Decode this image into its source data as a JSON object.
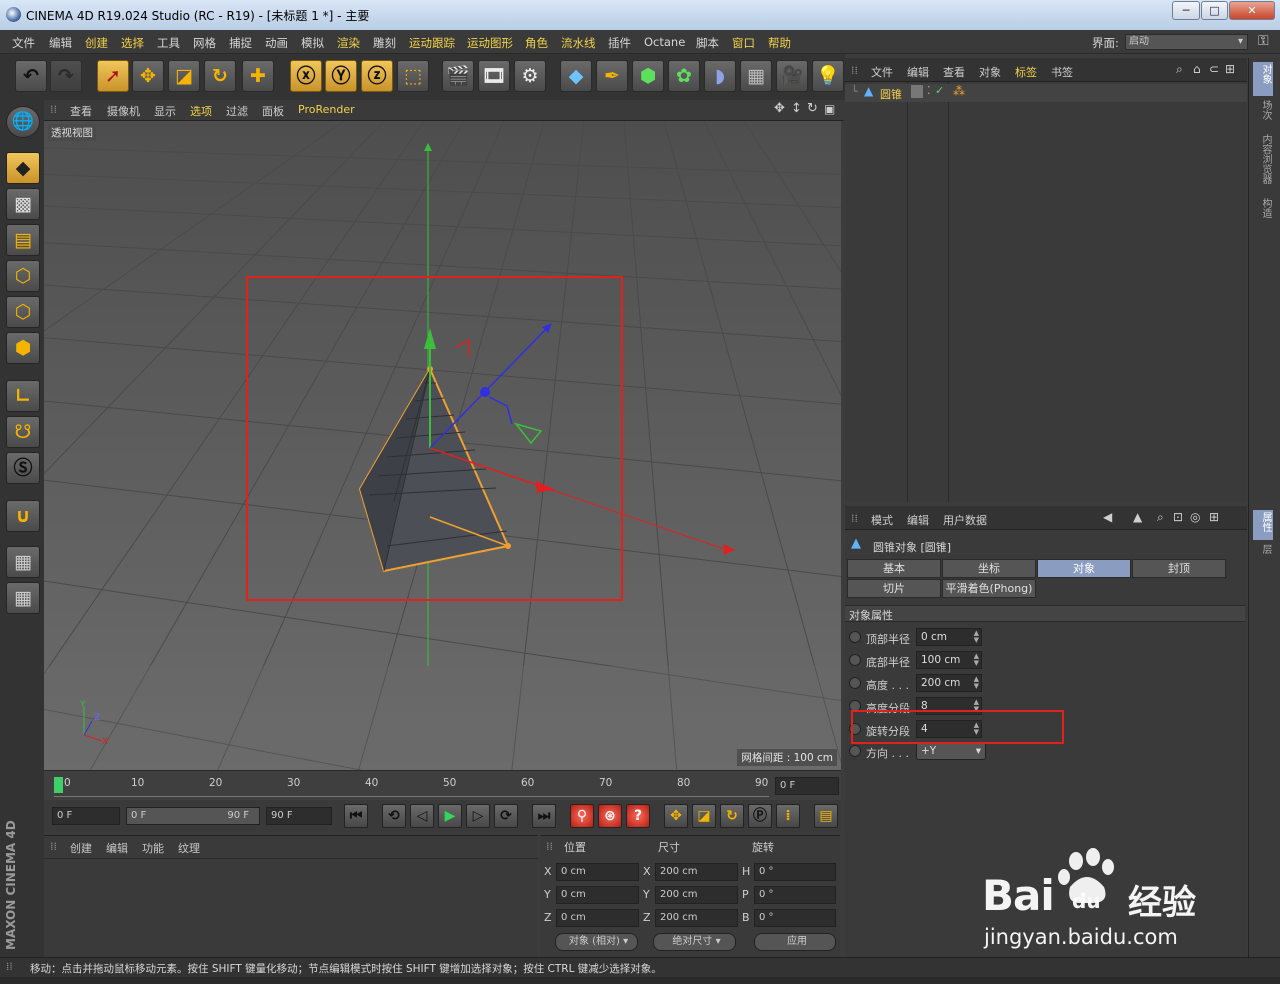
{
  "window": {
    "title": "CINEMA 4D R19.024 Studio (RC - R19) - [未标题 1 *] - 主要",
    "min_label": "─",
    "max_label": "□",
    "close_label": "✕"
  },
  "menu": {
    "items": [
      "文件",
      "编辑",
      "创建",
      "选择",
      "工具",
      "网格",
      "捕捉",
      "动画",
      "模拟",
      "渲染",
      "雕刻",
      "运动跟踪",
      "运动图形",
      "角色",
      "流水线",
      "插件",
      "Octane",
      "脚本",
      "窗口",
      "帮助"
    ],
    "interface_label": "界面:",
    "interface_value": "启动"
  },
  "viewport": {
    "menu": [
      "查看",
      "摄像机",
      "显示",
      "选项",
      "过滤",
      "面板",
      "ProRender"
    ],
    "view_name": "透视视图",
    "grid_spacing": "网格间距 : 100 cm",
    "axis_labels": {
      "x": "X",
      "y": "Y",
      "z": "Z"
    }
  },
  "timeline": {
    "ticks": [
      "0",
      "10",
      "20",
      "30",
      "40",
      "50",
      "60",
      "70",
      "80",
      "90"
    ],
    "current_frame": "0 F"
  },
  "playback": {
    "start": "0 F",
    "range_start": "0 F",
    "range_end": "90 F",
    "end": "90 F"
  },
  "material_panel": {
    "menu": [
      "创建",
      "编辑",
      "功能",
      "纹理"
    ]
  },
  "coord_panel": {
    "headers": [
      "位置",
      "尺寸",
      "旋转"
    ],
    "rows": [
      {
        "axis": "X",
        "pos": "0 cm",
        "size_axis": "X",
        "size": "200 cm",
        "rot_axis": "H",
        "rot": "0 °"
      },
      {
        "axis": "Y",
        "pos": "0 cm",
        "size_axis": "Y",
        "size": "200 cm",
        "rot_axis": "P",
        "rot": "0 °"
      },
      {
        "axis": "Z",
        "pos": "0 cm",
        "size_axis": "Z",
        "size": "200 cm",
        "rot_axis": "B",
        "rot": "0 °"
      }
    ],
    "mode": "对象 (相对)",
    "size_mode": "绝对尺寸",
    "apply": "应用"
  },
  "object_manager": {
    "menu": [
      "文件",
      "编辑",
      "查看",
      "对象",
      "标签",
      "书签"
    ],
    "objects": [
      {
        "name": "圆锥"
      }
    ]
  },
  "attribute_manager": {
    "menu": [
      "模式",
      "编辑",
      "用户数据"
    ],
    "object_title": "圆锥对象 [圆锥]",
    "tabs_row1": [
      "基本",
      "坐标",
      "对象",
      "封顶"
    ],
    "tabs_row2": [
      "切片",
      "平滑着色(Phong)"
    ],
    "active_tab": "对象",
    "section": "对象属性",
    "properties": [
      {
        "label": "顶部半径",
        "value": "0 cm"
      },
      {
        "label": "底部半径",
        "value": "100 cm"
      },
      {
        "label": "高度 . . .",
        "value": "200 cm"
      },
      {
        "label": "高度分段",
        "value": "8"
      },
      {
        "label": "旋转分段",
        "value": "4"
      },
      {
        "label": "方向 . . .",
        "value": "+Y"
      }
    ]
  },
  "right_tabs": [
    "对象",
    "场次",
    "内容浏览器",
    "构造",
    "属性",
    "层"
  ],
  "logo_text": "MAXON CINEMA 4D",
  "status": "移动：点击并拖动鼠标移动元素。按住 SHIFT 键量化移动；节点编辑模式时按住 SHIFT 键增加选择对象；按住 CTRL 键减少选择对象。",
  "watermark": {
    "brand": "Bai",
    "brand2": "du",
    "cn": "经验",
    "url": "jingyan.baidu.com"
  },
  "colors": {
    "accent": "#f0c65a",
    "highlight_red": "#e3211c",
    "active_tab": "#8a9cbf"
  }
}
